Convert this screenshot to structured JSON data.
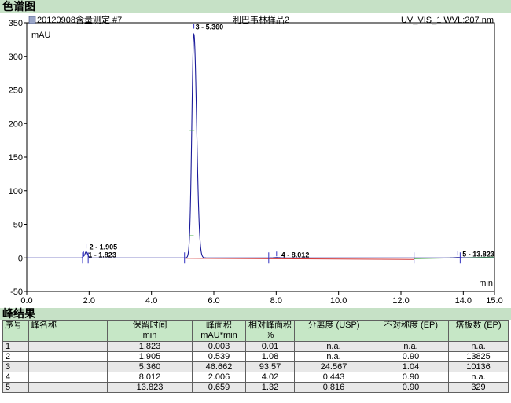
{
  "sections": {
    "chromatogram_title": "色谱图",
    "results_title": "峰结果"
  },
  "chart_header": {
    "left": "20120908含量测定 #7",
    "center": "利巴韦林样品2",
    "right": "UV_VIS_1 WVL:207 nm"
  },
  "chart_data": {
    "type": "line",
    "ylabel": "mAU",
    "xlabel": "min",
    "xlim": [
      0,
      15
    ],
    "ylim": [
      -50,
      350
    ],
    "xticks": [
      "0.0",
      "2.0",
      "4.0",
      "6.0",
      "8.0",
      "10.0",
      "12.0",
      "14.0",
      "15.0"
    ],
    "yticks": [
      "-50",
      "0",
      "50",
      "100",
      "150",
      "200",
      "250",
      "300",
      "350"
    ],
    "peaks": [
      {
        "label": "1 - 1.823",
        "rt": 1.823,
        "height": 2
      },
      {
        "label": "2 - 1.905",
        "rt": 1.905,
        "height": 9
      },
      {
        "label": "3 - 5.360",
        "rt": 5.36,
        "height": 333
      },
      {
        "label": "4 - 8.012",
        "rt": 8.012,
        "height": 0.5
      },
      {
        "label": "5 - 13.823",
        "rt": 13.823,
        "height": 0.5
      }
    ],
    "integration_markers": [
      1.79,
      1.97,
      5.06,
      7.76,
      12.42,
      13.9
    ]
  },
  "table": {
    "headers": [
      {
        "line1": "序号",
        "line2": ""
      },
      {
        "line1": "峰名称",
        "line2": ""
      },
      {
        "line1": "保留时间",
        "line2": "min"
      },
      {
        "line1": "峰面积",
        "line2": "mAU*min"
      },
      {
        "line1": "相对峰面积",
        "line2": "%"
      },
      {
        "line1": "分离度 (USP)",
        "line2": ""
      },
      {
        "line1": "不对称度 (EP)",
        "line2": ""
      },
      {
        "line1": "塔板数 (EP)",
        "line2": ""
      }
    ],
    "rows": [
      [
        "1",
        "",
        "1.823",
        "0.003",
        "0.01",
        "n.a.",
        "n.a.",
        "n.a."
      ],
      [
        "2",
        "",
        "1.905",
        "0.539",
        "1.08",
        "n.a.",
        "0.90",
        "13825"
      ],
      [
        "3",
        "",
        "5.360",
        "46.662",
        "93.57",
        "24.567",
        "1.04",
        "10136"
      ],
      [
        "4",
        "",
        "8.012",
        "2.006",
        "4.02",
        "0.443",
        "0.90",
        "n.a."
      ],
      [
        "5",
        "",
        "13.823",
        "0.659",
        "1.32",
        "0.816",
        "0.90",
        "329"
      ]
    ]
  }
}
